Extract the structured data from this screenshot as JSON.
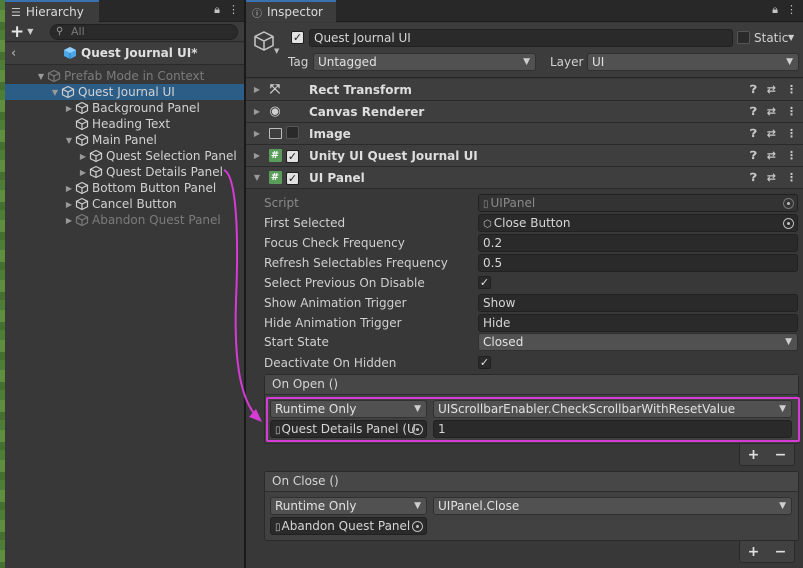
{
  "hierarchy": {
    "tab_label": "Hierarchy",
    "add_label": "+",
    "search_placeholder": "All",
    "scene_title": "Quest Journal UI*",
    "items": [
      {
        "label": "Prefab Mode in Context",
        "depth": 0,
        "expand": "down",
        "state": "dim"
      },
      {
        "label": "Quest Journal UI",
        "depth": 1,
        "expand": "down",
        "state": "selected"
      },
      {
        "label": "Background Panel",
        "depth": 2,
        "expand": "right",
        "state": "normal"
      },
      {
        "label": "Heading Text",
        "depth": 2,
        "expand": "none",
        "state": "normal"
      },
      {
        "label": "Main Panel",
        "depth": 2,
        "expand": "down",
        "state": "normal"
      },
      {
        "label": "Quest Selection Panel",
        "depth": 3,
        "expand": "right",
        "state": "normal"
      },
      {
        "label": "Quest Details Panel",
        "depth": 3,
        "expand": "right",
        "state": "normal"
      },
      {
        "label": "Bottom Button Panel",
        "depth": 2,
        "expand": "right",
        "state": "normal"
      },
      {
        "label": "Cancel Button",
        "depth": 2,
        "expand": "right",
        "state": "normal"
      },
      {
        "label": "Abandon Quest Panel",
        "depth": 2,
        "expand": "right",
        "state": "dim"
      }
    ]
  },
  "inspector": {
    "tab_label": "Inspector",
    "object_name": "Quest Journal UI",
    "static_label": "Static",
    "tag_label": "Tag",
    "tag_value": "Untagged",
    "layer_label": "Layer",
    "layer_value": "UI",
    "components": [
      {
        "name": "Rect Transform",
        "icon": "rect-transform-icon",
        "checkbox": "none"
      },
      {
        "name": "Canvas Renderer",
        "icon": "eye-icon",
        "checkbox": "none"
      },
      {
        "name": "Image",
        "icon": "image-icon",
        "checkbox": "unchecked"
      },
      {
        "name": "Unity UI Quest Journal UI",
        "icon": "script-hash-icon",
        "checkbox": "checked"
      },
      {
        "name": "UI Panel",
        "icon": "script-hash-icon",
        "checkbox": "checked"
      }
    ],
    "ui_panel": {
      "script_label": "Script",
      "script_value": "UIPanel",
      "first_selected_label": "First Selected",
      "first_selected_value": "Close Button",
      "focus_check_label": "Focus Check Frequency",
      "focus_check_value": "0.2",
      "refresh_label": "Refresh Selectables Frequency",
      "refresh_value": "0.5",
      "select_prev_label": "Select Previous On Disable",
      "show_anim_label": "Show Animation Trigger",
      "show_anim_value": "Show",
      "hide_anim_label": "Hide Animation Trigger",
      "hide_anim_value": "Hide",
      "start_state_label": "Start State",
      "start_state_value": "Closed",
      "deactivate_label": "Deactivate On Hidden"
    },
    "on_open": {
      "title": "On Open ()",
      "runtime": "Runtime Only",
      "function": "UIScrollbarEnabler.CheckScrollbarWithResetValue",
      "target": "Quest Details Panel (U",
      "argument": "1"
    },
    "on_close": {
      "title": "On Close ()",
      "runtime": "Runtime Only",
      "function": "UIPanel.Close",
      "target": "Abandon Quest Panel"
    },
    "plus_label": "+",
    "minus_label": "−"
  },
  "colors": {
    "selection": "#2c5d87",
    "highlight": "#d63bd6",
    "accent_tab": "#3a72b0"
  }
}
